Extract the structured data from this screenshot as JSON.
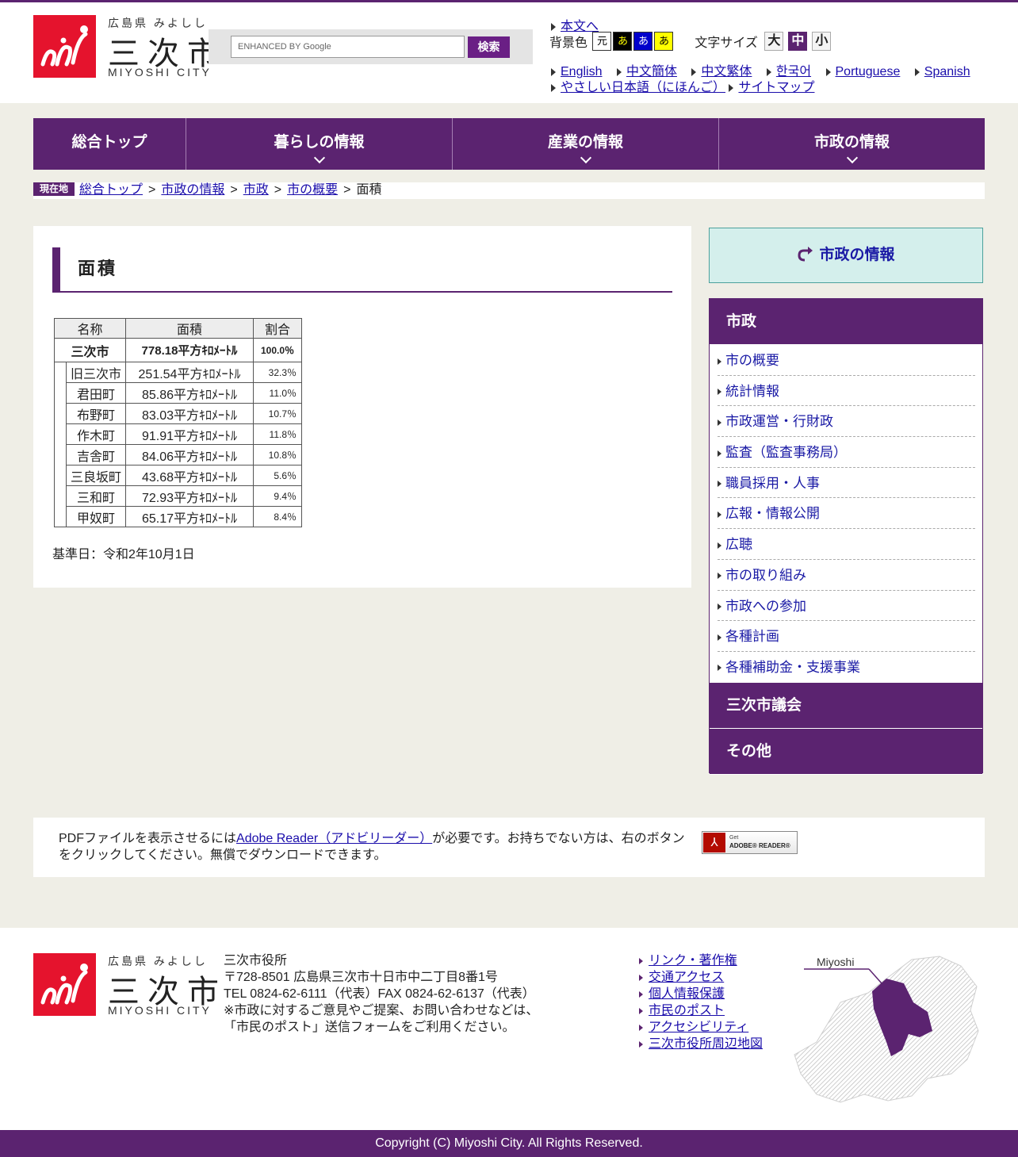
{
  "brand": {
    "pref": "広島県 みよしし",
    "city": "三次市",
    "roman": "MIYOSHI CITY",
    "color": "#5b2370",
    "logo_color": "#e5132d"
  },
  "search": {
    "placeholder": "ENHANCED BY Google",
    "button": "検索"
  },
  "utility": {
    "skip": "本文へ",
    "bg_label": "背景色",
    "bg_options": [
      "元",
      "あ",
      "あ",
      "あ"
    ],
    "size_label": "文字サイズ",
    "size_options": [
      "大",
      "中",
      "小"
    ],
    "languages": [
      "English",
      "中文簡体",
      "中文繁体",
      "한국어",
      "Portuguese",
      "Spanish"
    ],
    "easy_japanese": "やさしい日本語（にほんご）",
    "sitemap": "サイトマップ"
  },
  "gnav": [
    {
      "label": "総合トップ"
    },
    {
      "label": "暮らしの情報"
    },
    {
      "label": "産業の情報"
    },
    {
      "label": "市政の情報"
    }
  ],
  "breadcrumb": {
    "here": "現在地",
    "items": [
      "総合トップ",
      "市政の情報",
      "市政",
      "市の概要"
    ],
    "current": "面積",
    "sep": ">"
  },
  "page": {
    "title": "面積",
    "table": {
      "headers": [
        "名称",
        "面積",
        "割合"
      ],
      "total": {
        "name": "三次市",
        "area": "778.18平方ｷﾛﾒｰﾄﾙ",
        "ratio": "100.0％"
      },
      "rows": [
        {
          "name": "旧三次市",
          "area": "251.54平方ｷﾛﾒｰﾄﾙ",
          "ratio": "32.3％"
        },
        {
          "name": "君田町",
          "area": "85.86平方ｷﾛﾒｰﾄﾙ",
          "ratio": "11.0％"
        },
        {
          "name": "布野町",
          "area": "83.03平方ｷﾛﾒｰﾄﾙ",
          "ratio": "10.7％"
        },
        {
          "name": "作木町",
          "area": "91.91平方ｷﾛﾒｰﾄﾙ",
          "ratio": "11.8％"
        },
        {
          "name": "吉舎町",
          "area": "84.06平方ｷﾛﾒｰﾄﾙ",
          "ratio": "10.8％"
        },
        {
          "name": "三良坂町",
          "area": "43.68平方ｷﾛﾒｰﾄﾙ",
          "ratio": "5.6％"
        },
        {
          "name": "三和町",
          "area": "72.93平方ｷﾛﾒｰﾄﾙ",
          "ratio": "9.4％"
        },
        {
          "name": "甲奴町",
          "area": "65.17平方ｷﾛﾒｰﾄﾙ",
          "ratio": "8.4％"
        }
      ]
    },
    "note": "基準日：令和2年10月1日"
  },
  "sidebar": {
    "heading": "市政の情報",
    "category": "市政",
    "items": [
      "市の概要",
      "統計情報",
      "市政運営・行財政",
      "監査（監査事務局）",
      "職員採用・人事",
      "広報・情報公開",
      "広聴",
      "市の取り組み",
      "市政への参加",
      "各種計画",
      "各種補助金・支援事業"
    ],
    "categories_after": [
      "三次市議会",
      "その他"
    ]
  },
  "pdf": {
    "text_before": "PDFファイルを表示させるには",
    "link": "Adobe Reader（アドビリーダー）",
    "text_after": "が必要です。お持ちでない方は、右のボタンをクリックしてください。無償でダウンロードできます。",
    "badge_get": "Get",
    "badge_name": "ADOBE® READER®"
  },
  "footer": {
    "office": "三次市役所",
    "address": "〒728-8501 広島県三次市十日市中二丁目8番1号",
    "tel": "TEL 0824-62-6111（代表）FAX 0824-62-6137（代表）",
    "note1": "※市政に対するご意見やご提案、お問い合わせなどは、",
    "note2": "「市民のポスト」送信フォームをご利用ください。",
    "links": [
      "リンク・著作権",
      "交通アクセス",
      "個人情報保護",
      "市民のポスト",
      "アクセシビリティ",
      "三次市役所周辺地図"
    ],
    "map_label": "Miyoshi",
    "copyright": "Copyright (C) Miyoshi City. All Rights Reserved."
  }
}
